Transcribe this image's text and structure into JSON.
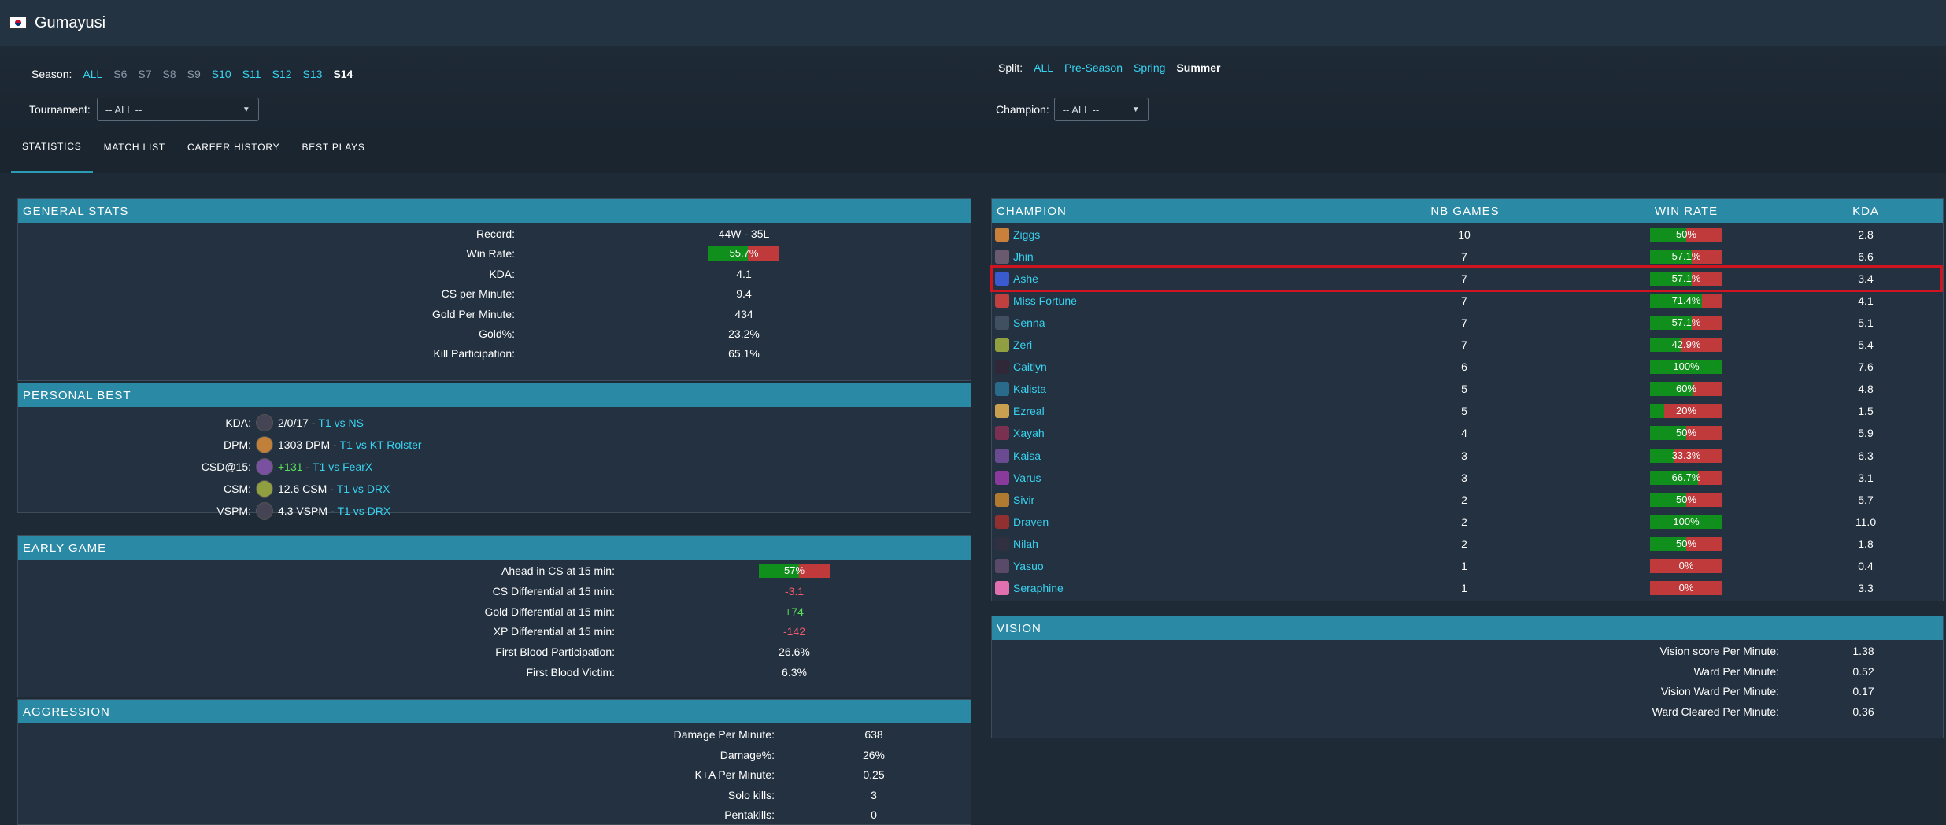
{
  "header": {
    "player_name": "Gumayusi",
    "flag_icon": "south-korea-flag-icon"
  },
  "filters": {
    "season_label": "Season:",
    "seasons": [
      {
        "label": "ALL",
        "state": "active"
      },
      {
        "label": "S6",
        "state": "inactive"
      },
      {
        "label": "S7",
        "state": "inactive"
      },
      {
        "label": "S8",
        "state": "inactive"
      },
      {
        "label": "S9",
        "state": "inactive"
      },
      {
        "label": "S10",
        "state": "active"
      },
      {
        "label": "S11",
        "state": "active"
      },
      {
        "label": "S12",
        "state": "active"
      },
      {
        "label": "S13",
        "state": "active"
      },
      {
        "label": "S14",
        "state": "selected"
      }
    ],
    "split_label": "Split:",
    "splits": [
      {
        "label": "ALL",
        "state": "active"
      },
      {
        "label": "Pre-Season",
        "state": "active"
      },
      {
        "label": "Spring",
        "state": "active"
      },
      {
        "label": "Summer",
        "state": "selected"
      }
    ],
    "tournament_label": "Tournament:",
    "tournament_value": "-- ALL --",
    "champion_label": "Champion:",
    "champion_value": "-- ALL --"
  },
  "tabs": [
    {
      "label": "STATISTICS",
      "active": true
    },
    {
      "label": "MATCH LIST",
      "active": false
    },
    {
      "label": "CAREER HISTORY",
      "active": false
    },
    {
      "label": "BEST PLAYS",
      "active": false
    }
  ],
  "general_stats": {
    "title": "GENERAL STATS",
    "record_label": "Record:",
    "record": "44W - 35L",
    "win_rate_label": "Win Rate:",
    "win_rate": "55.7%",
    "win_rate_value": 55.7,
    "kda_label": "KDA:",
    "kda": "4.1",
    "cspm_label": "CS per Minute:",
    "cspm": "9.4",
    "gpm_label": "Gold Per Minute:",
    "gpm": "434",
    "gold_pct_label": "Gold%:",
    "gold_pct": "23.2%",
    "kp_label": "Kill Participation:",
    "kp": "65.1%"
  },
  "personal_best": {
    "title": "PERSONAL BEST",
    "rows": [
      {
        "label": "KDA:",
        "value": "2/0/17",
        "sep": " - ",
        "match": "T1 vs NS",
        "value_color": "#ffffff"
      },
      {
        "label": "DPM:",
        "value": "1303 DPM",
        "sep": " - ",
        "match": "T1 vs KT Rolster",
        "value_color": "#ffffff"
      },
      {
        "label": "CSD@15:",
        "value": "+131",
        "sep": " - ",
        "match": "T1 vs FearX",
        "value_color": "#58e05a"
      },
      {
        "label": "CSM:",
        "value": "12.6 CSM",
        "sep": " - ",
        "match": "T1 vs DRX",
        "value_color": "#ffffff"
      },
      {
        "label": "VSPM:",
        "value": "4.3 VSPM",
        "sep": " - ",
        "match": "T1 vs DRX",
        "value_color": "#ffffff"
      }
    ]
  },
  "early_game": {
    "title": "EARLY GAME",
    "ahead_cs_label": "Ahead in CS at 15 min:",
    "ahead_cs": "57%",
    "ahead_cs_value": 57,
    "csd_label": "CS Differential at 15 min:",
    "csd": "-3.1",
    "gd_label": "Gold Differential at 15 min:",
    "gd": "+74",
    "xpd_label": "XP Differential at 15 min:",
    "xpd": "-142",
    "fbp_label": "First Blood Participation:",
    "fbp": "26.6%",
    "fbv_label": "First Blood Victim:",
    "fbv": "6.3%"
  },
  "aggression": {
    "title": "AGGRESSION",
    "dpm_label": "Damage Per Minute:",
    "dpm": "638",
    "dmg_pct_label": "Damage%:",
    "dmg_pct": "26%",
    "ka_label": "K+A Per Minute:",
    "ka": "0.25",
    "solo_label": "Solo kills:",
    "solo": "3",
    "penta_label": "Pentakills:",
    "penta": "0"
  },
  "champions": {
    "headers": {
      "champion": "CHAMPION",
      "games": "NB GAMES",
      "win_rate": "WIN RATE",
      "kda": "KDA"
    },
    "rows": [
      {
        "name": "Ziggs",
        "games": "10",
        "wr": "50%",
        "wr_value": 50,
        "kda": "2.8",
        "icon": "ziggs-icon",
        "color": "#c8803a"
      },
      {
        "name": "Jhin",
        "games": "7",
        "wr": "57.1%",
        "wr_value": 57.1,
        "kda": "6.6",
        "icon": "jhin-icon",
        "color": "#6a5a70"
      },
      {
        "name": "Ashe",
        "games": "7",
        "wr": "57.1%",
        "wr_value": 57.1,
        "kda": "3.4",
        "icon": "ashe-icon",
        "color": "#3a5ad0"
      },
      {
        "name": "Miss Fortune",
        "games": "7",
        "wr": "71.4%",
        "wr_value": 71.4,
        "kda": "4.1",
        "icon": "miss-fortune-icon",
        "color": "#c04040"
      },
      {
        "name": "Senna",
        "games": "7",
        "wr": "57.1%",
        "wr_value": 57.1,
        "kda": "5.1",
        "icon": "senna-icon",
        "color": "#405060"
      },
      {
        "name": "Zeri",
        "games": "7",
        "wr": "42.9%",
        "wr_value": 42.9,
        "kda": "5.4",
        "icon": "zeri-icon",
        "color": "#90a040"
      },
      {
        "name": "Caitlyn",
        "games": "6",
        "wr": "100%",
        "wr_value": 100,
        "kda": "7.6",
        "icon": "caitlyn-icon",
        "color": "#302838"
      },
      {
        "name": "Kalista",
        "games": "5",
        "wr": "60%",
        "wr_value": 60,
        "kda": "4.8",
        "icon": "kalista-icon",
        "color": "#2a6a8a"
      },
      {
        "name": "Ezreal",
        "games": "5",
        "wr": "20%",
        "wr_value": 20,
        "kda": "1.5",
        "icon": "ezreal-icon",
        "color": "#c8a050"
      },
      {
        "name": "Xayah",
        "games": "4",
        "wr": "50%",
        "wr_value": 50,
        "kda": "5.9",
        "icon": "xayah-icon",
        "color": "#7a3050"
      },
      {
        "name": "Kaisa",
        "games": "3",
        "wr": "33.3%",
        "wr_value": 33.3,
        "kda": "6.3",
        "icon": "kaisa-icon",
        "color": "#6a4a90"
      },
      {
        "name": "Varus",
        "games": "3",
        "wr": "66.7%",
        "wr_value": 66.7,
        "kda": "3.1",
        "icon": "varus-icon",
        "color": "#8a3a9a"
      },
      {
        "name": "Sivir",
        "games": "2",
        "wr": "50%",
        "wr_value": 50,
        "kda": "5.7",
        "icon": "sivir-icon",
        "color": "#b07a30"
      },
      {
        "name": "Draven",
        "games": "2",
        "wr": "100%",
        "wr_value": 100,
        "kda": "11.0",
        "icon": "draven-icon",
        "color": "#903030"
      },
      {
        "name": "Nilah",
        "games": "2",
        "wr": "50%",
        "wr_value": 50,
        "kda": "1.8",
        "icon": "nilah-icon",
        "color": "#303040"
      },
      {
        "name": "Yasuo",
        "games": "1",
        "wr": "0%",
        "wr_value": 0,
        "kda": "0.4",
        "icon": "yasuo-icon",
        "color": "#5a4a6a"
      },
      {
        "name": "Seraphine",
        "games": "1",
        "wr": "0%",
        "wr_value": 0,
        "kda": "3.3",
        "icon": "seraphine-icon",
        "color": "#e070b0"
      }
    ]
  },
  "vision": {
    "title": "VISION",
    "vspm_label": "Vision score Per Minute:",
    "vspm": "1.38",
    "wpm_label": "Ward Per Minute:",
    "wpm": "0.52",
    "vwpm_label": "Vision Ward Per Minute:",
    "vwpm": "0.17",
    "wcpm_label": "Ward Cleared Per Minute:",
    "wcpm": "0.36"
  },
  "colors": {
    "accent": "#2a8aa6",
    "link": "#38d3f0",
    "win": "#118f1c",
    "loss": "#c0393b",
    "highlight": "#d01420"
  }
}
